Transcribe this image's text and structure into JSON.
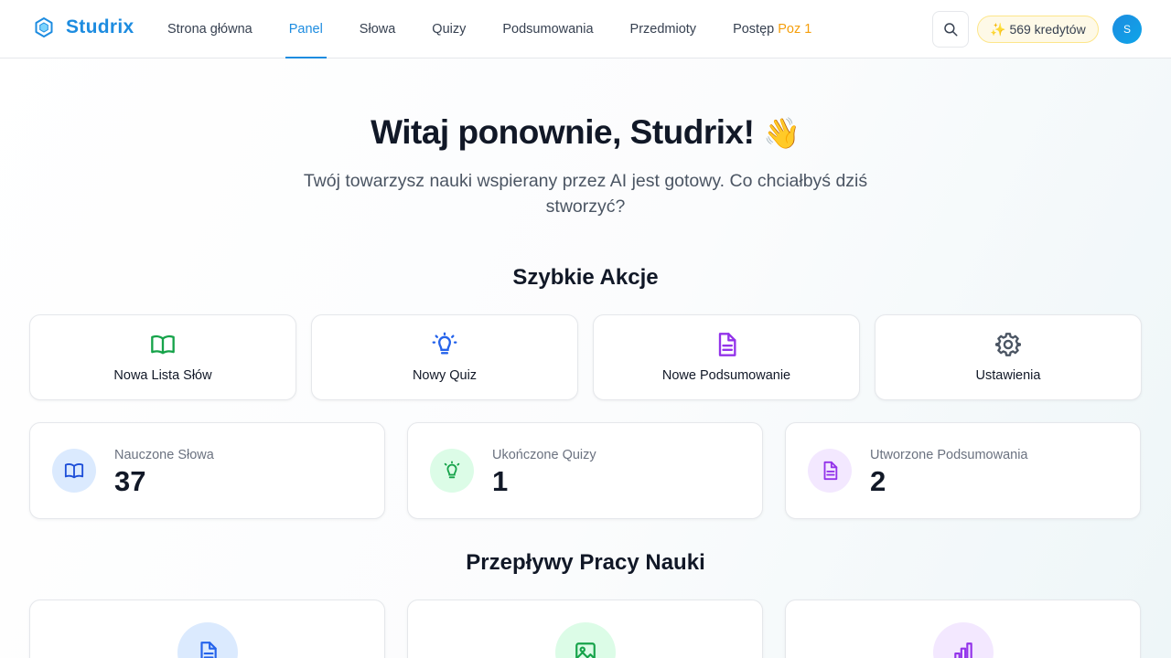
{
  "brand": {
    "name": "Studrix",
    "icon": "hexagon-logo-icon"
  },
  "nav": {
    "items": [
      {
        "label": "Strona główna"
      },
      {
        "label": "Panel",
        "active": true
      },
      {
        "label": "Słowa"
      },
      {
        "label": "Quizy"
      },
      {
        "label": "Podsumowania"
      },
      {
        "label": "Przedmioty"
      },
      {
        "label": "Postęp",
        "badge": "Poz 1"
      }
    ]
  },
  "header": {
    "search_icon": "search-icon",
    "credits_emoji": "✨",
    "credits_label": "569 kredytów",
    "avatar_initial": "S"
  },
  "hero": {
    "title": "Witaj ponownie, Studrix!",
    "emoji": "👋",
    "subtitle": "Twój towarzysz nauki wspierany przez AI jest gotowy. Co chciałbyś dziś stworzyć?"
  },
  "quick_actions": {
    "title": "Szybkie Akcje",
    "items": [
      {
        "label": "Nowa Lista Słów",
        "icon": "book-open-icon",
        "color": "#16a34a"
      },
      {
        "label": "Nowy Quiz",
        "icon": "lightbulb-icon",
        "color": "#2563eb"
      },
      {
        "label": "Nowe Podsumowanie",
        "icon": "document-icon",
        "color": "#9333ea"
      },
      {
        "label": "Ustawienia",
        "icon": "gear-icon",
        "color": "#4b5563"
      }
    ]
  },
  "stats": [
    {
      "label": "Nauczone Słowa",
      "value": "37",
      "icon": "book-open-icon",
      "color": "#1d4ed8",
      "bg": "#dbeafe"
    },
    {
      "label": "Ukończone Quizy",
      "value": "1",
      "icon": "lightbulb-icon",
      "color": "#16a34a",
      "bg": "#dcfce7"
    },
    {
      "label": "Utworzone Podsumowania",
      "value": "2",
      "icon": "document-icon",
      "color": "#9333ea",
      "bg": "#f3e8ff"
    }
  ],
  "workflows": {
    "title": "Przepływy Pracy Nauki",
    "items": [
      {
        "icon": "document-icon",
        "color": "#2563eb",
        "bg": "#dbeafe"
      },
      {
        "icon": "image-icon",
        "color": "#16a34a",
        "bg": "#dcfce7"
      },
      {
        "icon": "bar-chart-icon",
        "color": "#9333ea",
        "bg": "#f3e8ff"
      }
    ]
  }
}
